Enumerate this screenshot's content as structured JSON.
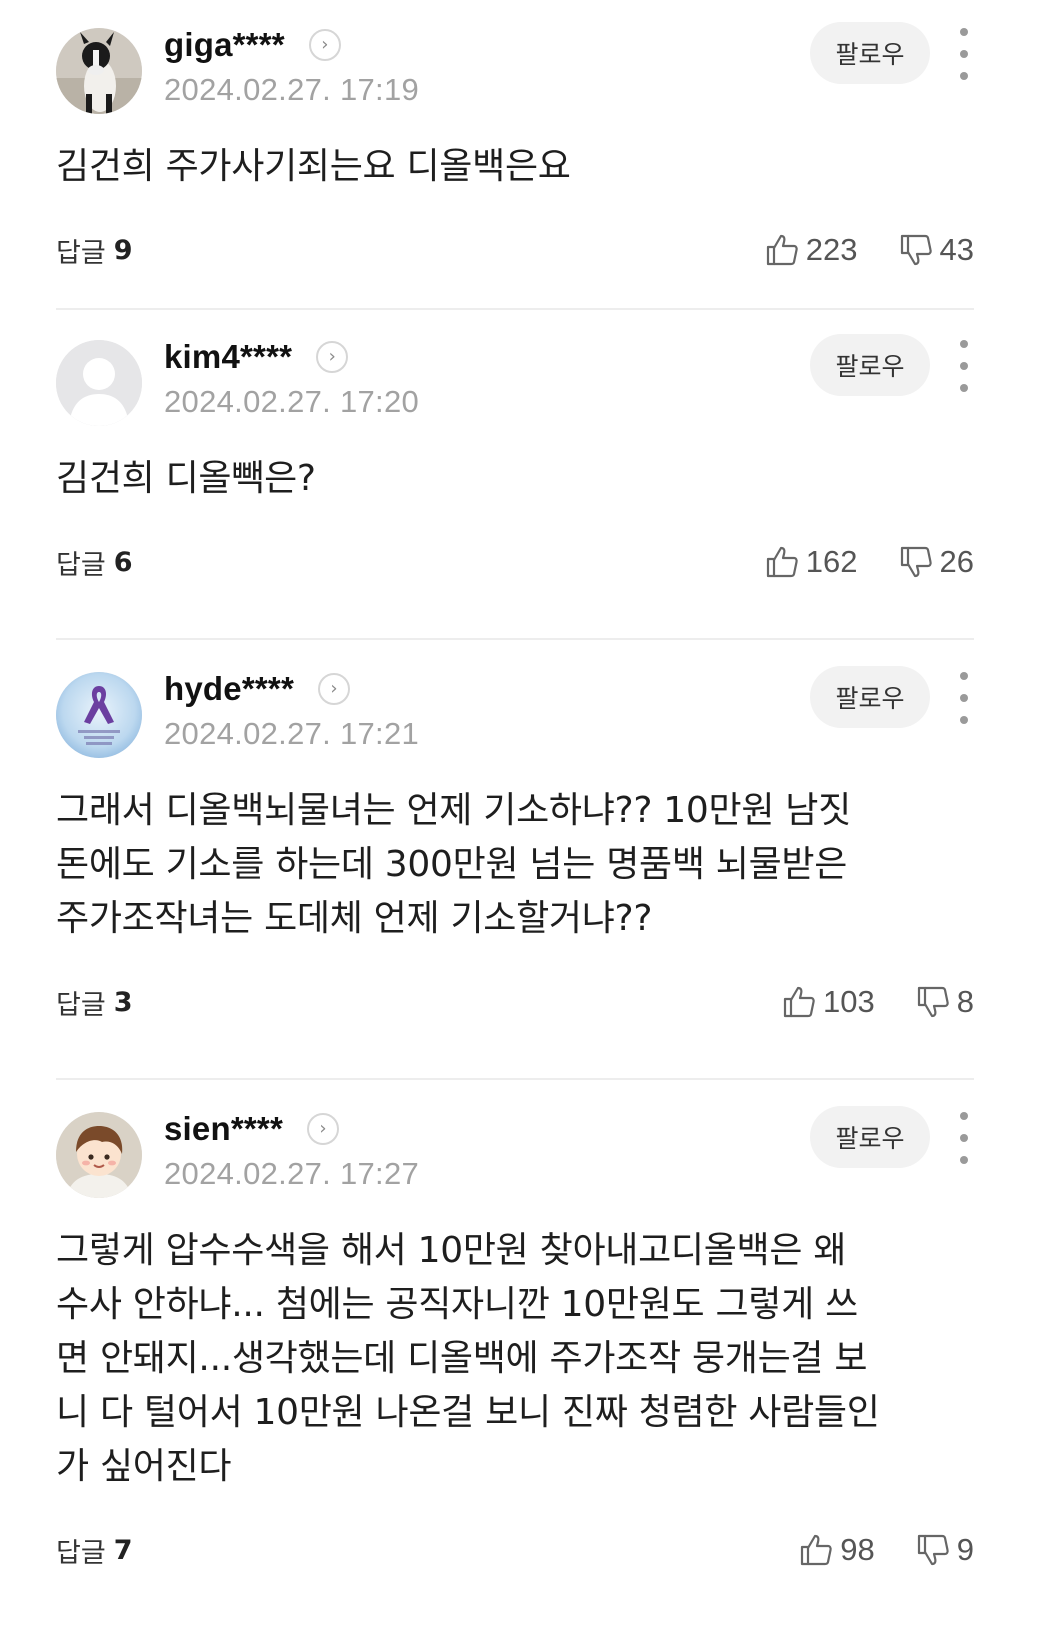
{
  "follow_label": "팔로우",
  "reply_label": "답글",
  "comments": [
    {
      "username": "giga****",
      "date": "2024.02.27. 17:19",
      "text": "김건희 주가사기죄는요 디올백은요",
      "replies": "9",
      "likes": "223",
      "dislikes": "43",
      "avatar": "dog-photo-avatar"
    },
    {
      "username": "kim4****",
      "date": "2024.02.27. 17:20",
      "text": "김건희 디올빽은?",
      "replies": "6",
      "likes": "162",
      "dislikes": "26",
      "avatar": "default-person-avatar"
    },
    {
      "username": "hyde****",
      "date": "2024.02.27. 17:21",
      "text": "그래서 디올백뇌물녀는 언제 기소하냐?? 10만원 남짓\n돈에도 기소를 하는데 300만원 넘는 명품백 뇌물받은\n주가조작녀는 도데체 언제 기소할거냐??",
      "replies": "3",
      "likes": "103",
      "dislikes": "8",
      "avatar": "purple-ribbon-avatar"
    },
    {
      "username": "sien****",
      "date": "2024.02.27. 17:27",
      "text": "그렇게 압수수색을 해서 10만원 찾아내고디올백은 왜\n수사 안하냐... 첨에는 공직자니깐 10만원도 그렇게 쓰\n면 안돼지...생각했는데 디올백에 주가조작 뭉개는걸 보\n니 다 털어서 10만원 나온걸 보니 진짜 청렴한 사람들인\n가 싶어진다",
      "replies": "7",
      "likes": "98",
      "dislikes": "9",
      "avatar": "cartoon-kid-avatar"
    }
  ]
}
